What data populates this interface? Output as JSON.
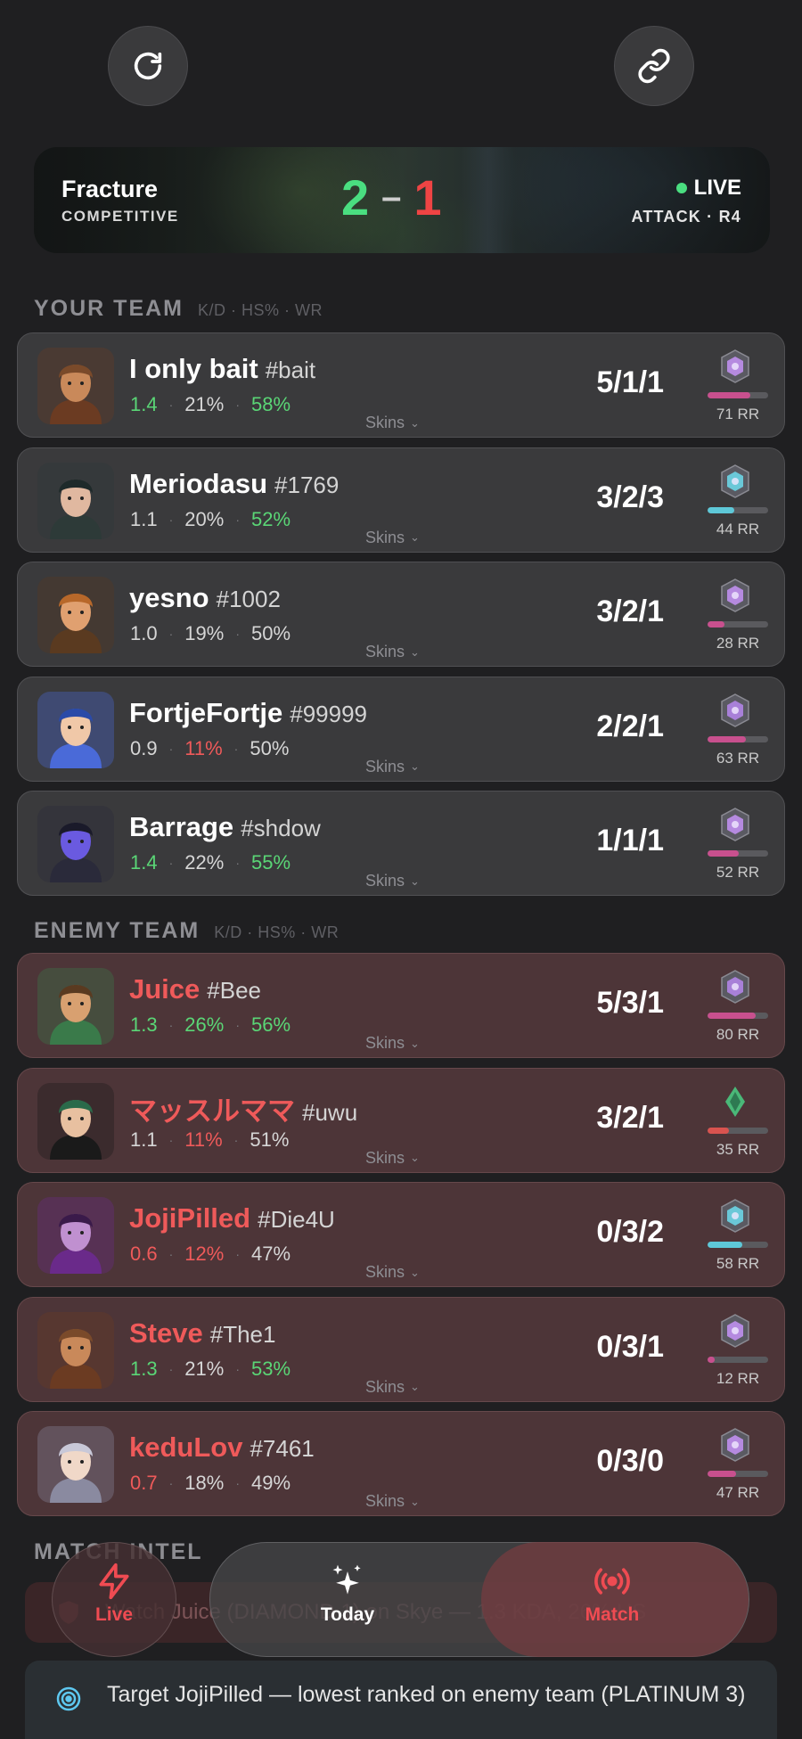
{
  "header": {
    "refresh_icon": "refresh-icon",
    "link_icon": "link-icon"
  },
  "match": {
    "map": "Fracture",
    "mode": "COMPETITIVE",
    "score_ally": "2",
    "score_separator": "–",
    "score_enemy": "1",
    "status": "LIVE",
    "round": "ATTACK · R4"
  },
  "your_team": {
    "title": "YOUR TEAM",
    "subtitle": "K/D · HS% · WR",
    "players": [
      {
        "name": "I only bait",
        "tag": "#bait",
        "kd": "1.4",
        "hs": "21%",
        "wr": "58%",
        "kda": "5/1/1",
        "rr": "71 RR",
        "rr_value": 71,
        "skins": "Skins"
      },
      {
        "name": "Meriodasu",
        "tag": "#1769",
        "kd": "1.1",
        "hs": "20%",
        "wr": "52%",
        "kda": "3/2/3",
        "rr": "44 RR",
        "rr_value": 44,
        "skins": "Skins"
      },
      {
        "name": "yesno",
        "tag": "#1002",
        "kd": "1.0",
        "hs": "19%",
        "wr": "50%",
        "kda": "3/2/1",
        "rr": "28 RR",
        "rr_value": 28,
        "skins": "Skins"
      },
      {
        "name": "FortjeFortje",
        "tag": "#99999",
        "kd": "0.9",
        "hs": "11%",
        "wr": "50%",
        "kda": "2/2/1",
        "rr": "63 RR",
        "rr_value": 63,
        "skins": "Skins"
      },
      {
        "name": "Barrage",
        "tag": "#shdow",
        "kd": "1.4",
        "hs": "22%",
        "wr": "55%",
        "kda": "1/1/1",
        "rr": "52 RR",
        "rr_value": 52,
        "skins": "Skins"
      }
    ]
  },
  "enemy_team": {
    "title": "ENEMY TEAM",
    "subtitle": "K/D · HS% · WR",
    "players": [
      {
        "name": "Juice",
        "tag": "#Bee",
        "kd": "1.3",
        "hs": "26%",
        "wr": "56%",
        "kda": "5/3/1",
        "rr": "80 RR",
        "rr_value": 80,
        "skins": "Skins"
      },
      {
        "name": "マッスルママ",
        "tag": "#uwu",
        "kd": "1.1",
        "hs": "11%",
        "wr": "51%",
        "kda": "3/2/1",
        "rr": "35 RR",
        "rr_value": 35,
        "skins": "Skins"
      },
      {
        "name": "JojiPilled",
        "tag": "#Die4U",
        "kd": "0.6",
        "hs": "12%",
        "wr": "47%",
        "kda": "0/3/2",
        "rr": "58 RR",
        "rr_value": 58,
        "skins": "Skins"
      },
      {
        "name": "Steve",
        "tag": "#The1",
        "kd": "1.3",
        "hs": "21%",
        "wr": "53%",
        "kda": "0/3/1",
        "rr": "12 RR",
        "rr_value": 12,
        "skins": "Skins"
      },
      {
        "name": "keduLov",
        "tag": "#7461",
        "kd": "0.7",
        "hs": "18%",
        "wr": "49%",
        "kda": "0/3/0",
        "rr": "47 RR",
        "rr_value": 47,
        "skins": "Skins"
      }
    ]
  },
  "intel": {
    "title": "MATCH INTEL",
    "alert": "Watch Juice (DIAMOND 1) on Skye — 1.3 KDA, 26% HS",
    "target": "Target JojiPilled — lowest ranked on enemy team (PLATINUM 3)"
  },
  "tabs": {
    "live": "Live",
    "today": "Today",
    "match": "Match"
  },
  "colors": {
    "ally_green": "#4ade80",
    "enemy_red": "#ef4444",
    "rr_pink": "#c8508e",
    "rr_cyan": "#5ec8d8",
    "rr_red": "#d9534f"
  }
}
